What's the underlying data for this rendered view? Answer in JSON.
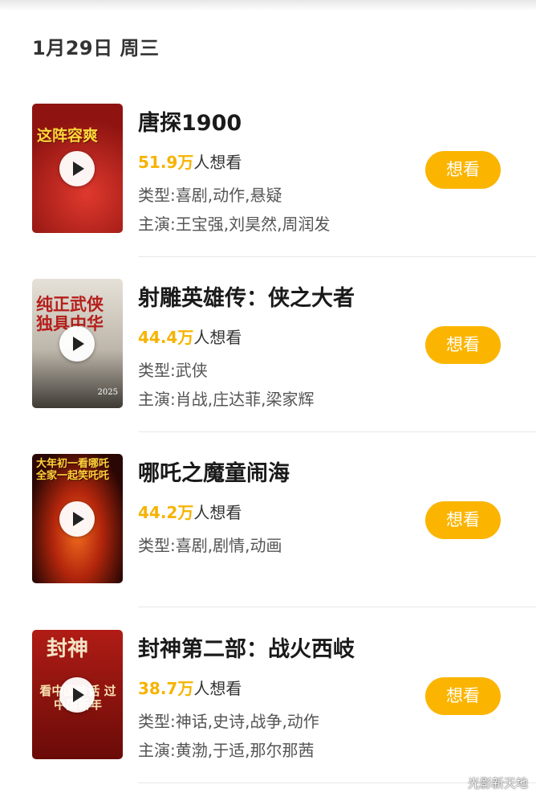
{
  "date_header": "1月29日 周三",
  "want_suffix": "人想看",
  "movies": [
    {
      "title": "唐探1900",
      "want_count": "51.9万",
      "genre": "类型:喜剧,动作,悬疑",
      "cast": "主演:王宝强,刘昊然,周润发",
      "button": "想看",
      "poster_text": "这阵容爽",
      "poster_colors": [
        "#c3231f",
        "#6d0e0c"
      ]
    },
    {
      "title": "射雕英雄传：侠之大者",
      "want_count": "44.4万",
      "genre": "类型:武侠",
      "cast": "主演:肖战,庄达菲,梁家辉",
      "button": "想看",
      "poster_text": "纯正武侠 独具中华",
      "poster_year": "2025",
      "poster_colors": [
        "#d9d4cb",
        "#3c3834"
      ]
    },
    {
      "title": "哪吒之魔童闹海",
      "want_count": "44.2万",
      "genre": "类型:喜剧,剧情,动画",
      "button": "想看",
      "poster_text": "大年初一看哪吒 全家一起笑吒吒",
      "poster_colors": [
        "#e0531a",
        "#2a0704"
      ]
    },
    {
      "title": "封神第二部：战火西岐",
      "want_count": "38.7万",
      "genre": "类型:神话,史诗,战争,动作",
      "cast": "主演:黄渤,于适,那尔那茜",
      "button": "想看",
      "poster_text": "封神",
      "poster_slogan": "看中国神话 过中国新年",
      "poster_colors": [
        "#a81812",
        "#5e0906"
      ]
    }
  ],
  "watermark": "光影新天地"
}
